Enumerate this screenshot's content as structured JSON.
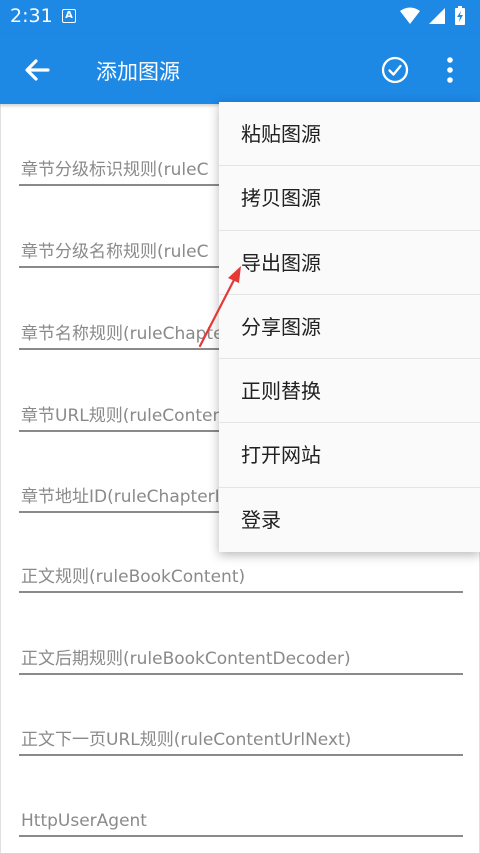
{
  "status_bar": {
    "time": "2:31",
    "app_icon_letter": "A"
  },
  "app_bar": {
    "title": "添加图源",
    "back_icon": "arrow-back-icon",
    "save_icon": "check-circle-icon",
    "more_icon": "more-vert-icon"
  },
  "colors": {
    "primary": "#1e88e5",
    "annotation": "#e53935"
  },
  "form": {
    "fields": [
      {
        "label": "章节分级标识规则(ruleC"
      },
      {
        "label": "章节分级名称规则(ruleC"
      },
      {
        "label": "章节名称规则(ruleChapte"
      },
      {
        "label": "章节URL规则(ruleConten"
      },
      {
        "label": "章节地址ID(ruleChapterI"
      },
      {
        "label": "正文规则(ruleBookContent)"
      },
      {
        "label": "正文后期规则(ruleBookContentDecoder)"
      },
      {
        "label": "正文下一页URL规则(ruleContentUrlNext)"
      },
      {
        "label": "HttpUserAgent"
      }
    ]
  },
  "menu": {
    "items": [
      {
        "label": "粘贴图源"
      },
      {
        "label": "拷贝图源"
      },
      {
        "label": "导出图源"
      },
      {
        "label": "分享图源"
      },
      {
        "label": "正则替换"
      },
      {
        "label": "打开网站"
      },
      {
        "label": "登录"
      }
    ]
  }
}
